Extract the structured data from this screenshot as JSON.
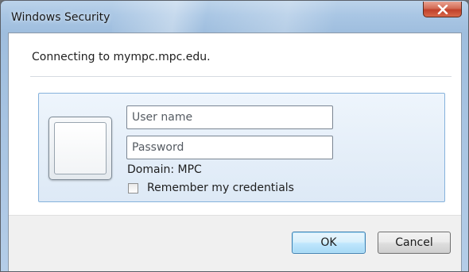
{
  "window": {
    "title": "Windows Security",
    "close_icon": "close-icon"
  },
  "dialog": {
    "message": "Connecting to mympc.mpc.edu.",
    "user_tile_icon": "user-tile-icon",
    "username": {
      "value": "",
      "placeholder": "User name"
    },
    "password": {
      "value": "",
      "placeholder": "Password"
    },
    "domain_text": "Domain: MPC",
    "remember_label": "Remember my credentials",
    "remember_checked": false
  },
  "buttons": {
    "ok_label": "OK",
    "cancel_label": "Cancel"
  },
  "colors": {
    "titlebar": "#a9c6e4",
    "close_button": "#c0412a",
    "credential_panel": "#dde9f6",
    "default_button_border": "#3c7fb1"
  }
}
